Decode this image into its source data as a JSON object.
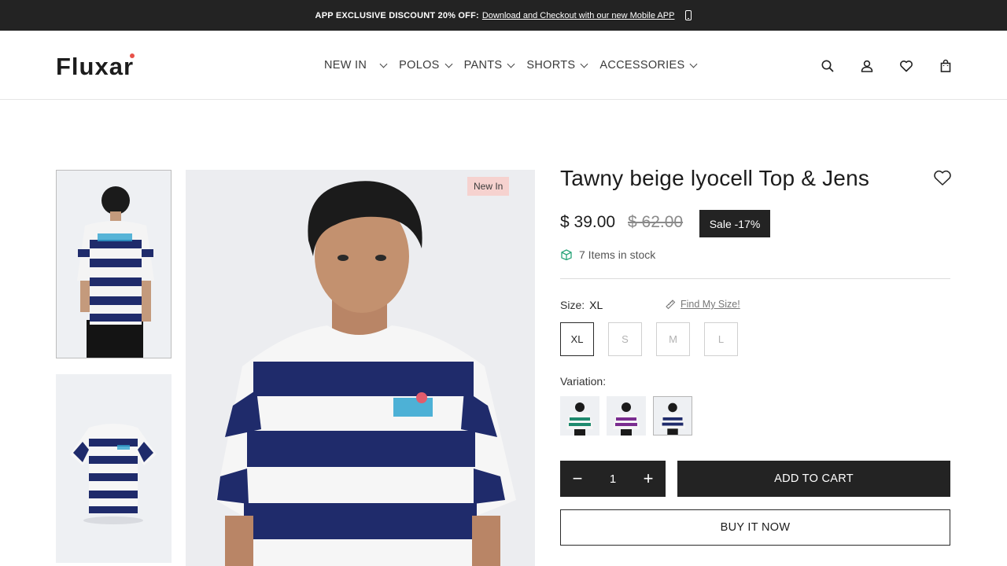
{
  "announcement": {
    "prefix": "APP EXCLUSIVE DISCOUNT 20% OFF:",
    "link": "Download and Checkout with our new Mobile APP",
    "icon": "mobile-phone-icon"
  },
  "header": {
    "logo": "Fluxar",
    "nav": [
      {
        "label": "NEW IN"
      },
      {
        "label": "POLOS"
      },
      {
        "label": "PANTS"
      },
      {
        "label": "SHORTS"
      },
      {
        "label": "ACCESSORIES"
      }
    ],
    "icons": [
      "search-icon",
      "account-icon",
      "wishlist-icon",
      "cart-icon"
    ]
  },
  "gallery": {
    "badge": "New In",
    "colors": {
      "navy": "#1f2b6b",
      "white": "#f6f6f6",
      "background": "#ecedf0"
    }
  },
  "product": {
    "title": "Tawny beige lyocell Top & Jens",
    "price": "$ 39.00",
    "compare_price": "$ 62.00",
    "sale_badge": "Sale -17%",
    "stock_text": "7 Items in stock",
    "size_label": "Size:",
    "size_value": "XL",
    "find_size": "Find My Size!",
    "sizes": [
      "XL",
      "S",
      "M",
      "L"
    ],
    "selected_size": "XL",
    "variation_label": "Variation:",
    "variations": [
      {
        "name": "green",
        "color": "#1f8a6e"
      },
      {
        "name": "purple",
        "color": "#7a2d8f"
      },
      {
        "name": "navy",
        "color": "#1f2b6b"
      }
    ],
    "quantity": "1",
    "qty_minus": "−",
    "qty_plus": "+",
    "add_to_cart": "ADD TO CART",
    "buy_now": "BUY IT NOW"
  }
}
